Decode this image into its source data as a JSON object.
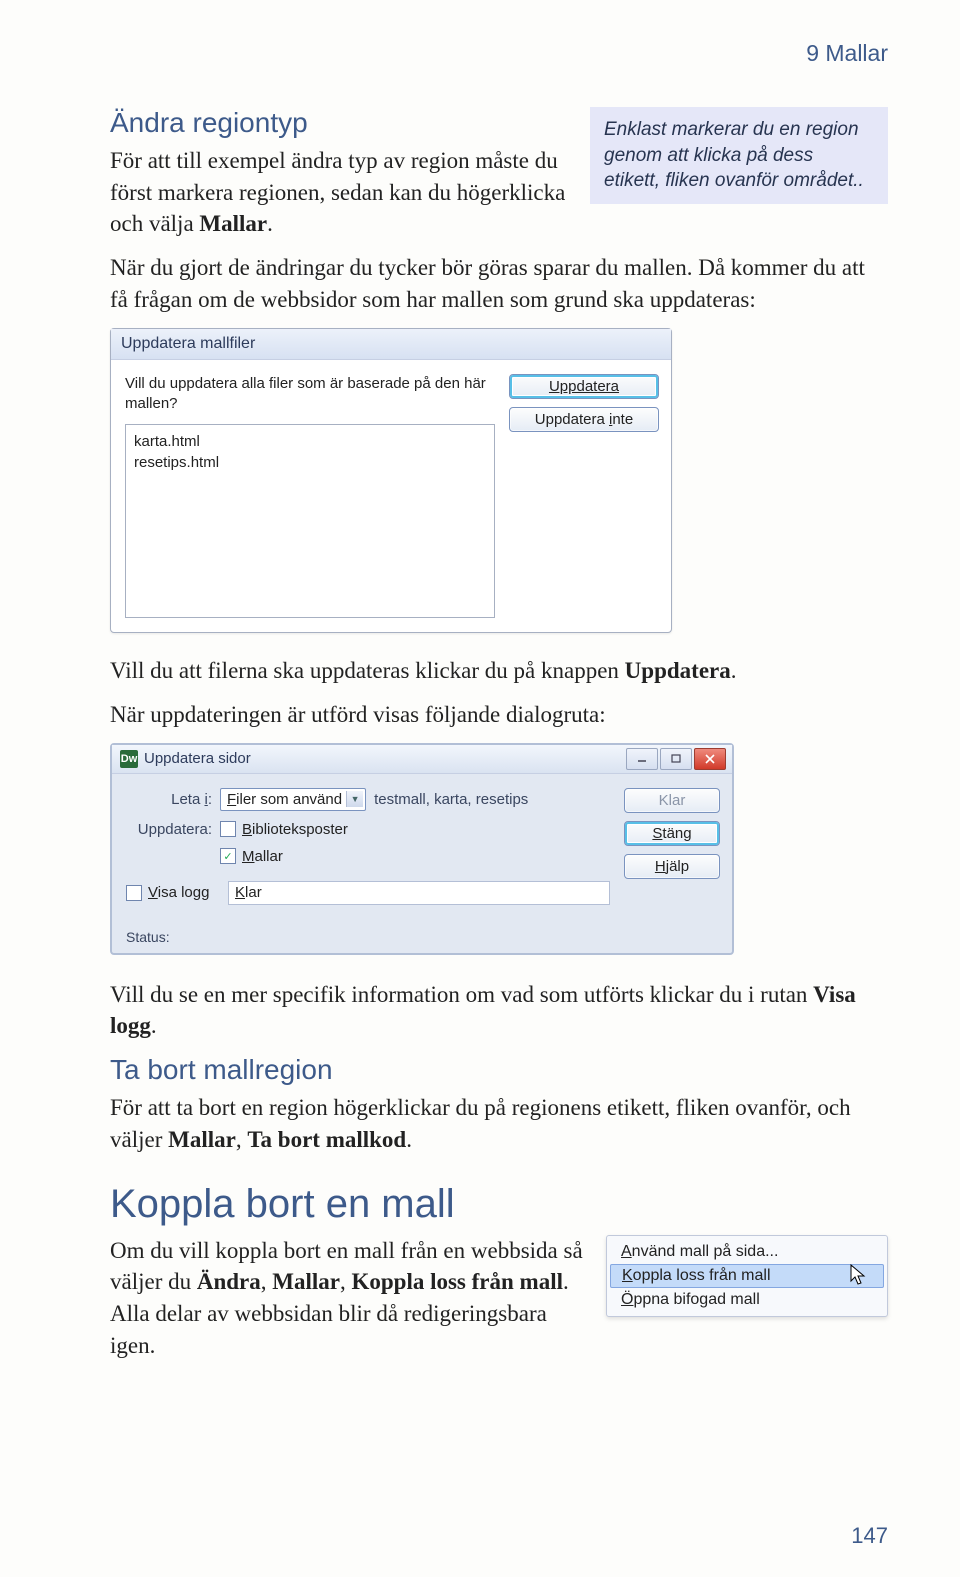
{
  "header_right": "9 Mallar",
  "section1": {
    "heading": "Ändra regiontyp",
    "p1a": "För att till exempel ändra typ av region måste du först markera regionen, sedan kan du högerklicka och välja ",
    "p1b": "Mallar",
    "p1c": ".",
    "tip": "Enklast markerar du en region genom att klicka på dess etikett, fliken ovanför området..",
    "p2": "När du gjort de ändringar du tycker bör göras sparar du mallen. Då kommer du att få frågan om de webbsidor som har mallen som grund ska uppdateras:"
  },
  "dialog1": {
    "title": "Uppdatera mallfiler",
    "question": "Vill du uppdatera alla filer som är baserade på den här mallen?",
    "files": [
      "karta.html",
      "resetips.html"
    ],
    "btn_update": "Uppdatera",
    "btn_noupdate": "Uppdatera inte"
  },
  "section2": {
    "p1a": "Vill du att filerna ska uppdateras klickar du på knappen ",
    "p1b": "Uppdatera",
    "p1c": ".",
    "p2": "När uppdateringen är utförd visas följande dialogruta:"
  },
  "dialog2": {
    "title": "Uppdatera sidor",
    "leta_i_label": "Leta i:",
    "leta_i_value": "Filer som använd",
    "leta_i_extra": "testmall, karta, resetips",
    "uppdatera_label": "Uppdatera:",
    "chk_biblio_label": "Biblioteksposter",
    "chk_biblio_checked": false,
    "chk_mallar_label": "Mallar",
    "chk_mallar_checked": true,
    "chk_visa_logg_label": "Visa logg",
    "chk_visa_logg_checked": false,
    "klar_field": "Klar",
    "btn_klar": "Klar",
    "btn_stang": "Stäng",
    "btn_hjalp": "Hjälp",
    "status_label": "Status:"
  },
  "section3": {
    "p1a": "Vill du se en mer specifik information om vad som utförts klickar du i rutan ",
    "p1b": "Visa logg",
    "p1c": ".",
    "sub_heading": "Ta bort mallregion",
    "p2a": "För att ta bort en region högerklickar du på regionens etikett, fliken ovanför, och väljer ",
    "p2b": "Mallar",
    "p2c": ", ",
    "p2d": "Ta bort mallkod",
    "p2e": "."
  },
  "section4": {
    "heading": "Koppla bort en mall",
    "p1a": "Om du vill koppla bort en mall från en webbsida så väljer du ",
    "p1b": "Ändra",
    "p1c": ", ",
    "p1d": "Mallar",
    "p1e": ", ",
    "p1f": "Koppla loss från mall",
    "p1g": ". Alla delar av webbsidan blir då redigeringsbara igen.",
    "menu": {
      "item1": "Använd mall på sida...",
      "item2": "Koppla loss från mall",
      "item3": "Öppna bifogad mall"
    }
  },
  "page_number": "147"
}
